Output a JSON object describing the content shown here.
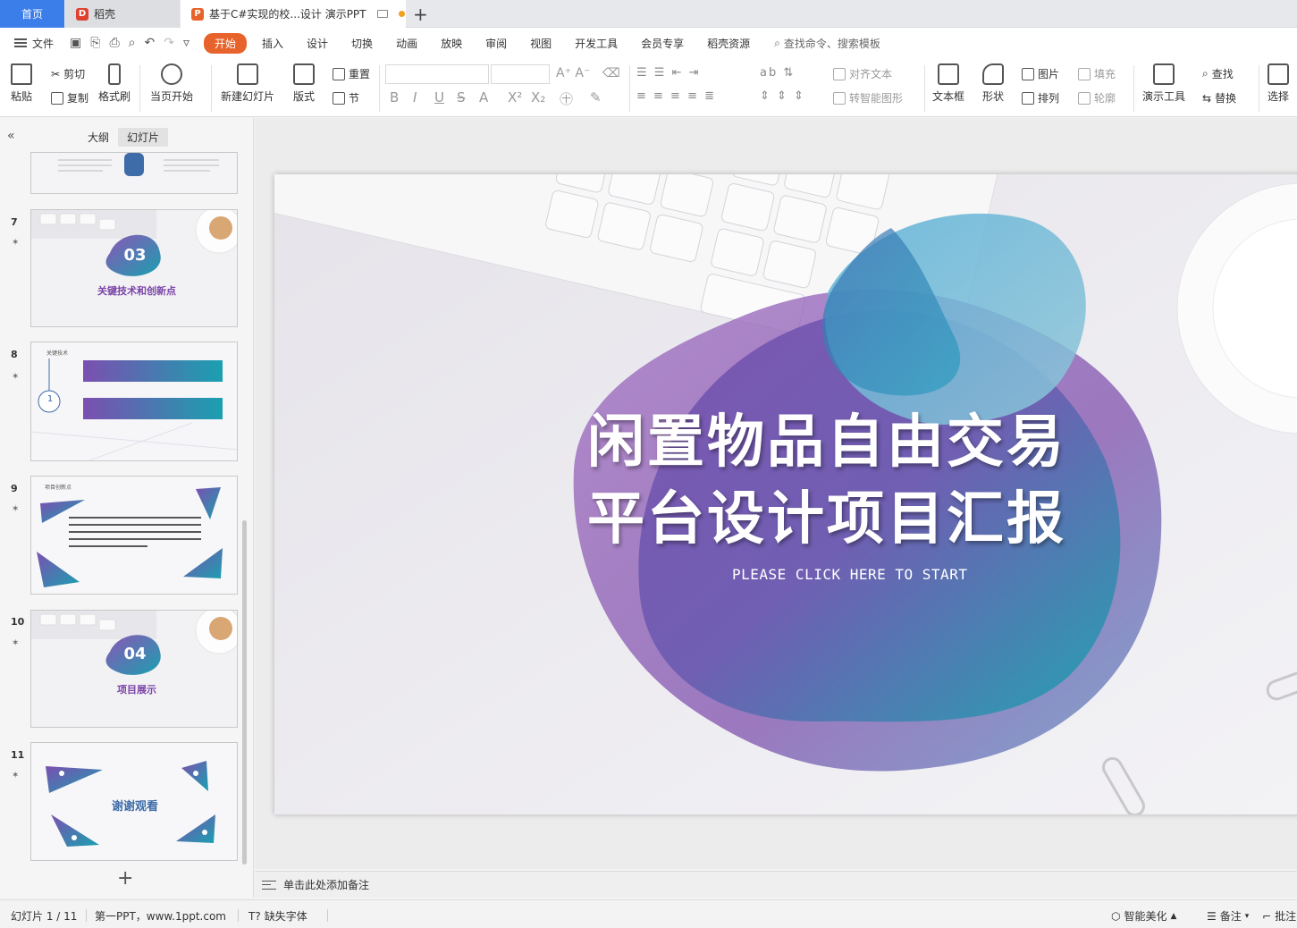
{
  "tabs": {
    "home": "首页",
    "daoke": "稻壳",
    "doc": "基于C#实现的校...设计 演示PPT"
  },
  "menu": {
    "file": "文件",
    "items": [
      "开始",
      "插入",
      "设计",
      "切换",
      "动画",
      "放映",
      "审阅",
      "视图",
      "开发工具",
      "会员专享",
      "稻壳资源"
    ],
    "search": "查找命令、搜索模板"
  },
  "ribbon": {
    "paste": "粘贴",
    "cut": "剪切",
    "copy": "复制",
    "format_painter": "格式刷",
    "play_from_current": "当页开始",
    "new_slide": "新建幻灯片",
    "layout": "版式",
    "reset": "重置",
    "section": "节",
    "align_text": "对齐文本",
    "smart_shape": "转智能图形",
    "textbox": "文本框",
    "shape": "形状",
    "picture": "图片",
    "arrange": "排列",
    "fill": "填充",
    "outline": "轮廓",
    "present_tools": "演示工具",
    "find": "查找",
    "replace": "替换",
    "select": "选择"
  },
  "leftpanel": {
    "tab_outline": "大纲",
    "tab_slides": "幻灯片",
    "slides": [
      {
        "num": "7",
        "badge": "03",
        "caption": "关键技术和创新点"
      },
      {
        "num": "8",
        "heading": "关键技术",
        "circle": "1"
      },
      {
        "num": "9",
        "heading": "项目创新点"
      },
      {
        "num": "10",
        "badge": "04",
        "caption": "项目展示"
      },
      {
        "num": "11",
        "caption": "谢谢观看"
      }
    ]
  },
  "slide": {
    "title_line1": "闲置物品自由交易",
    "title_line2": "平台设计项目汇报",
    "subtitle": "PLEASE CLICK HERE TO START"
  },
  "notes": {
    "placeholder": "单击此处添加备注"
  },
  "statusbar": {
    "slide_counter": "幻灯片 1 / 11",
    "theme": "第一PPT，www.1ppt.com",
    "missing_font": "缺失字体",
    "beautify": "智能美化",
    "notes": "备注",
    "comment": "批注"
  },
  "colors": {
    "accent": "#e8632b",
    "home_tab": "#3b7de9",
    "blob_purple": "#8a57b3",
    "blob_teal": "#1f9fb0",
    "blob_blue": "#3a6aad"
  }
}
